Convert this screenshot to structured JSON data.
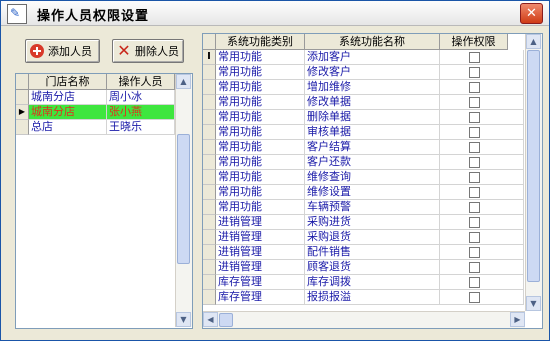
{
  "window": {
    "title": "操作人员权限设置",
    "app_icon": "pen-icon",
    "close_icon": "close-icon"
  },
  "toolbar": {
    "add_label": "添加人员",
    "delete_label": "删除人员"
  },
  "staff_grid": {
    "headers": [
      "门店名称",
      "操作人员"
    ],
    "rows": [
      {
        "store": "城南分店",
        "person": "周小冰",
        "selected": false
      },
      {
        "store": "城南分店",
        "person": "张小燕",
        "selected": true
      },
      {
        "store": "总店",
        "person": "王晓乐",
        "selected": false
      }
    ]
  },
  "perm_grid": {
    "headers": [
      "系统功能类别",
      "系统功能名称",
      "操作权限"
    ],
    "rows": [
      {
        "category": "常用功能",
        "name": "添加客户",
        "allowed": false
      },
      {
        "category": "常用功能",
        "name": "修改客户",
        "allowed": false
      },
      {
        "category": "常用功能",
        "name": "增加维修",
        "allowed": false
      },
      {
        "category": "常用功能",
        "name": "修改单据",
        "allowed": false
      },
      {
        "category": "常用功能",
        "name": "删除单据",
        "allowed": false
      },
      {
        "category": "常用功能",
        "name": "审核单据",
        "allowed": false
      },
      {
        "category": "常用功能",
        "name": "客户结算",
        "allowed": false
      },
      {
        "category": "常用功能",
        "name": "客户还款",
        "allowed": false
      },
      {
        "category": "常用功能",
        "name": "维修查询",
        "allowed": false
      },
      {
        "category": "常用功能",
        "name": "维修设置",
        "allowed": false
      },
      {
        "category": "常用功能",
        "name": "车辆预警",
        "allowed": false
      },
      {
        "category": "进销管理",
        "name": "采购进货",
        "allowed": false
      },
      {
        "category": "进销管理",
        "name": "采购退货",
        "allowed": false
      },
      {
        "category": "进销管理",
        "name": "配件销售",
        "allowed": false
      },
      {
        "category": "进销管理",
        "name": "顾客退货",
        "allowed": false
      },
      {
        "category": "库存管理",
        "name": "库存调拨",
        "allowed": false
      },
      {
        "category": "库存管理",
        "name": "报损报溢",
        "allowed": false
      }
    ]
  },
  "colors": {
    "selected_row": "#3ee63e",
    "selected_text": "#e0301e",
    "cell_text": "#1a1aa8"
  }
}
